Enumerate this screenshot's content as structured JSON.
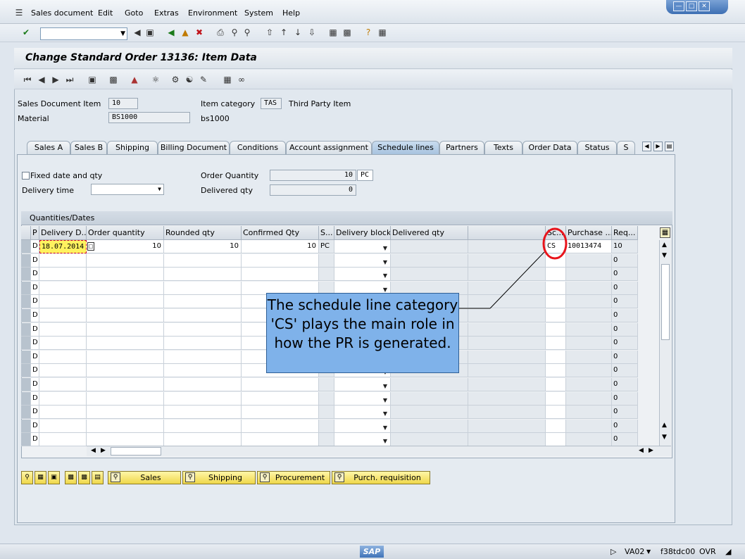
{
  "menu": {
    "items": [
      "Sales document",
      "Edit",
      "Goto",
      "Extras",
      "Environment",
      "System",
      "Help"
    ]
  },
  "window": {
    "title": "Change Standard Order 13136: Item Data"
  },
  "header": {
    "sales_doc_item_label": "Sales Document Item",
    "sales_doc_item_value": "10",
    "material_label": "Material",
    "material_value": "BS1000",
    "item_category_label": "Item category",
    "item_category_value": "TAS",
    "item_category_desc": "Third Party Item",
    "material_desc": "bs1000"
  },
  "tabs": [
    {
      "label": "Sales A"
    },
    {
      "label": "Sales B"
    },
    {
      "label": "Shipping"
    },
    {
      "label": "Billing Document"
    },
    {
      "label": "Conditions"
    },
    {
      "label": "Account assignment"
    },
    {
      "label": "Schedule lines"
    },
    {
      "label": "Partners"
    },
    {
      "label": "Texts"
    },
    {
      "label": "Order Data"
    },
    {
      "label": "Status"
    },
    {
      "label": "S"
    }
  ],
  "schedule": {
    "fixed_label": "Fixed date and qty",
    "delivery_time_label": "Delivery time",
    "order_qty_label": "Order Quantity",
    "order_qty_value": "10",
    "order_qty_unit": "PC",
    "delivered_qty_label": "Delivered qty",
    "delivered_qty_value": "0"
  },
  "grid": {
    "title": "Quantities/Dates",
    "columns": [
      "P",
      "Delivery D...",
      "Order quantity",
      "Rounded qty",
      "Confirmed Qty",
      "S...",
      "Delivery block",
      "Delivered qty",
      "",
      "Sc...",
      "Purchase ...",
      "Req..."
    ],
    "first_row": {
      "p": "D",
      "date": "18.07.2014",
      "order_qty": "10",
      "rounded_qty": "10",
      "confirmed_qty": "10",
      "unit": "PC",
      "sched_cat": "CS",
      "purchase": "10013474",
      "req": "10"
    },
    "empty_row_p": "D",
    "empty_row_req": "0"
  },
  "callout": {
    "text": "The schedule line category 'CS' plays the main role in how the PR is generated."
  },
  "buttons": {
    "sales": "Sales",
    "shipping": "Shipping",
    "procurement": "Procurement",
    "purch_req": "Purch. requisition"
  },
  "status": {
    "transaction": "VA02",
    "server": "f38tdc00",
    "mode": "OVR",
    "logo": "SAP"
  },
  "colors": {
    "callout_bg": "#7fb2ea",
    "highlight_circle": "#e8141b",
    "date_cell": "#fff25f"
  }
}
